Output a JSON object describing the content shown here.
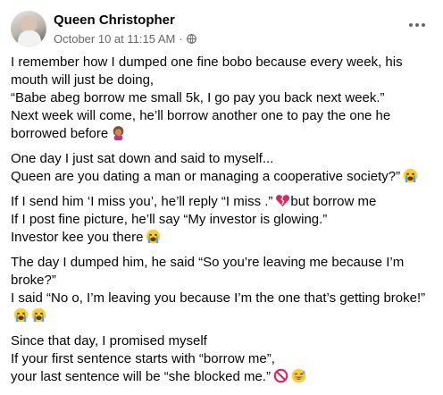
{
  "post": {
    "author": "Queen Christopher",
    "timestamp": "October 10 at 11:15 AM",
    "separator": "·",
    "privacy_icon": "globe-icon",
    "more_icon": "more-options-icon"
  },
  "paragraphs": [
    {
      "lines": [
        {
          "text": "I remember how I dumped one fine bobo because every week, his"
        },
        {
          "text": "mouth will just be doing,"
        },
        {
          "text": "“Babe abeg borrow me small 5k, I go pay you back next week.”"
        },
        {
          "text": "Next week will come, he’ll borrow another one to pay the one he"
        },
        {
          "text": "borrowed before",
          "emoji": "facepalm-woman"
        }
      ]
    },
    {
      "lines": [
        {
          "text": "One day I just sat down and said to myself..."
        },
        {
          "text": "Queen  are you dating a man or managing a cooperative society?”",
          "emoji": "crying-face"
        }
      ]
    },
    {
      "lines": [
        {
          "text": "If I send him ‘I miss you’, he’ll reply “I miss .”",
          "emoji": "broken-heart",
          "after": "but borrow me"
        },
        {
          "text": "If I post fine picture, he’ll say “My investor is glowing.”"
        },
        {
          "text": "Investor kee you there",
          "emoji": "crying-face"
        }
      ]
    },
    {
      "lines": [
        {
          "text": "The day I dumped him, he said “So you’re leaving me because I’m"
        },
        {
          "text": "broke?”"
        },
        {
          "text": "I said “No o, I’m leaving you because I’m the one that’s getting broke!”"
        },
        {
          "text": "",
          "emoji": "crying-face",
          "emoji2": "crying-face"
        }
      ]
    },
    {
      "lines": [
        {
          "text": "Since that day, I promised myself"
        },
        {
          "text": "If your first sentence starts with “borrow me”,"
        },
        {
          "text": "your last sentence will be “she blocked me.”",
          "emoji": "prohibited-sign",
          "emoji2": "grinning-sweat-face"
        }
      ]
    }
  ],
  "colors": {
    "text": "#050505",
    "secondary": "#65676b",
    "background": "#ffffff"
  }
}
